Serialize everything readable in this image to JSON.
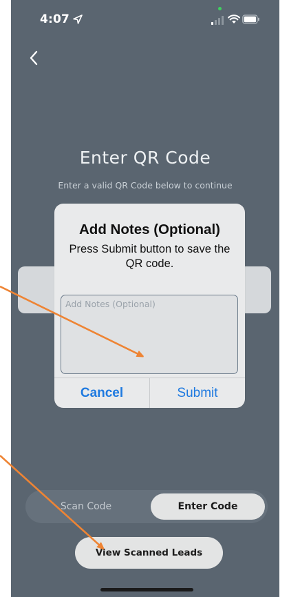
{
  "status_bar": {
    "time": "4:07",
    "location_icon": "location-arrow-icon",
    "signal_icon": "cellular-signal-icon",
    "wifi_icon": "wifi-icon",
    "battery_icon": "battery-icon"
  },
  "nav": {
    "back_icon": "chevron-left-icon"
  },
  "header": {
    "title": "Enter QR Code",
    "subtitle": "Enter a valid QR Code below to continue"
  },
  "dialog": {
    "title": "Add Notes (Optional)",
    "message": "Press Submit button to save the QR code.",
    "notes_placeholder": "Add Notes (Optional)",
    "notes_value": "",
    "cancel_label": "Cancel",
    "submit_label": "Submit"
  },
  "segmented": {
    "scan_label": "Scan Code",
    "enter_label": "Enter Code",
    "selected": "Enter Code"
  },
  "actions": {
    "view_leads_label": "View Scanned Leads"
  },
  "colors": {
    "background": "#5a6570",
    "dialog_background": "#e9eaeb",
    "button_blue": "#1f7ae0",
    "annotation_arrow": "#ee8434"
  }
}
